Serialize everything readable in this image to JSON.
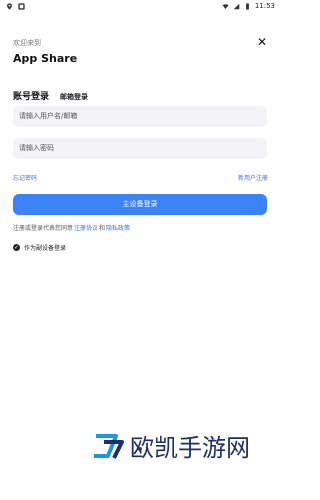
{
  "status_bar": {
    "time": "11:53",
    "icons": [
      "location-icon",
      "notification-icon",
      "wifi-icon",
      "signal-icon",
      "battery-icon"
    ]
  },
  "header": {
    "welcome": "欢迎来到",
    "title": "App Share"
  },
  "tabs": {
    "account_login": "账号登录",
    "email_login": "邮箱登录"
  },
  "form": {
    "username_placeholder": "请输入用户名/邮箱",
    "password_placeholder": "请输入密码",
    "forgot_password": "忘记密码",
    "register": "新用户注册",
    "login_button": "主设备登录"
  },
  "agreement": {
    "prefix": "注册或登录代表您同意",
    "user_agreement": "注册协议",
    "and": "和",
    "privacy_policy": "隐私政策"
  },
  "secondary_device": {
    "label": "作为副设备登录",
    "checked": true
  },
  "watermark": {
    "text": "欧凯手游网"
  },
  "colors": {
    "accent": "#3b82f6",
    "link": "#4a6fd0",
    "input_bg": "#f3f3f5",
    "watermark": "#1f2f66"
  }
}
